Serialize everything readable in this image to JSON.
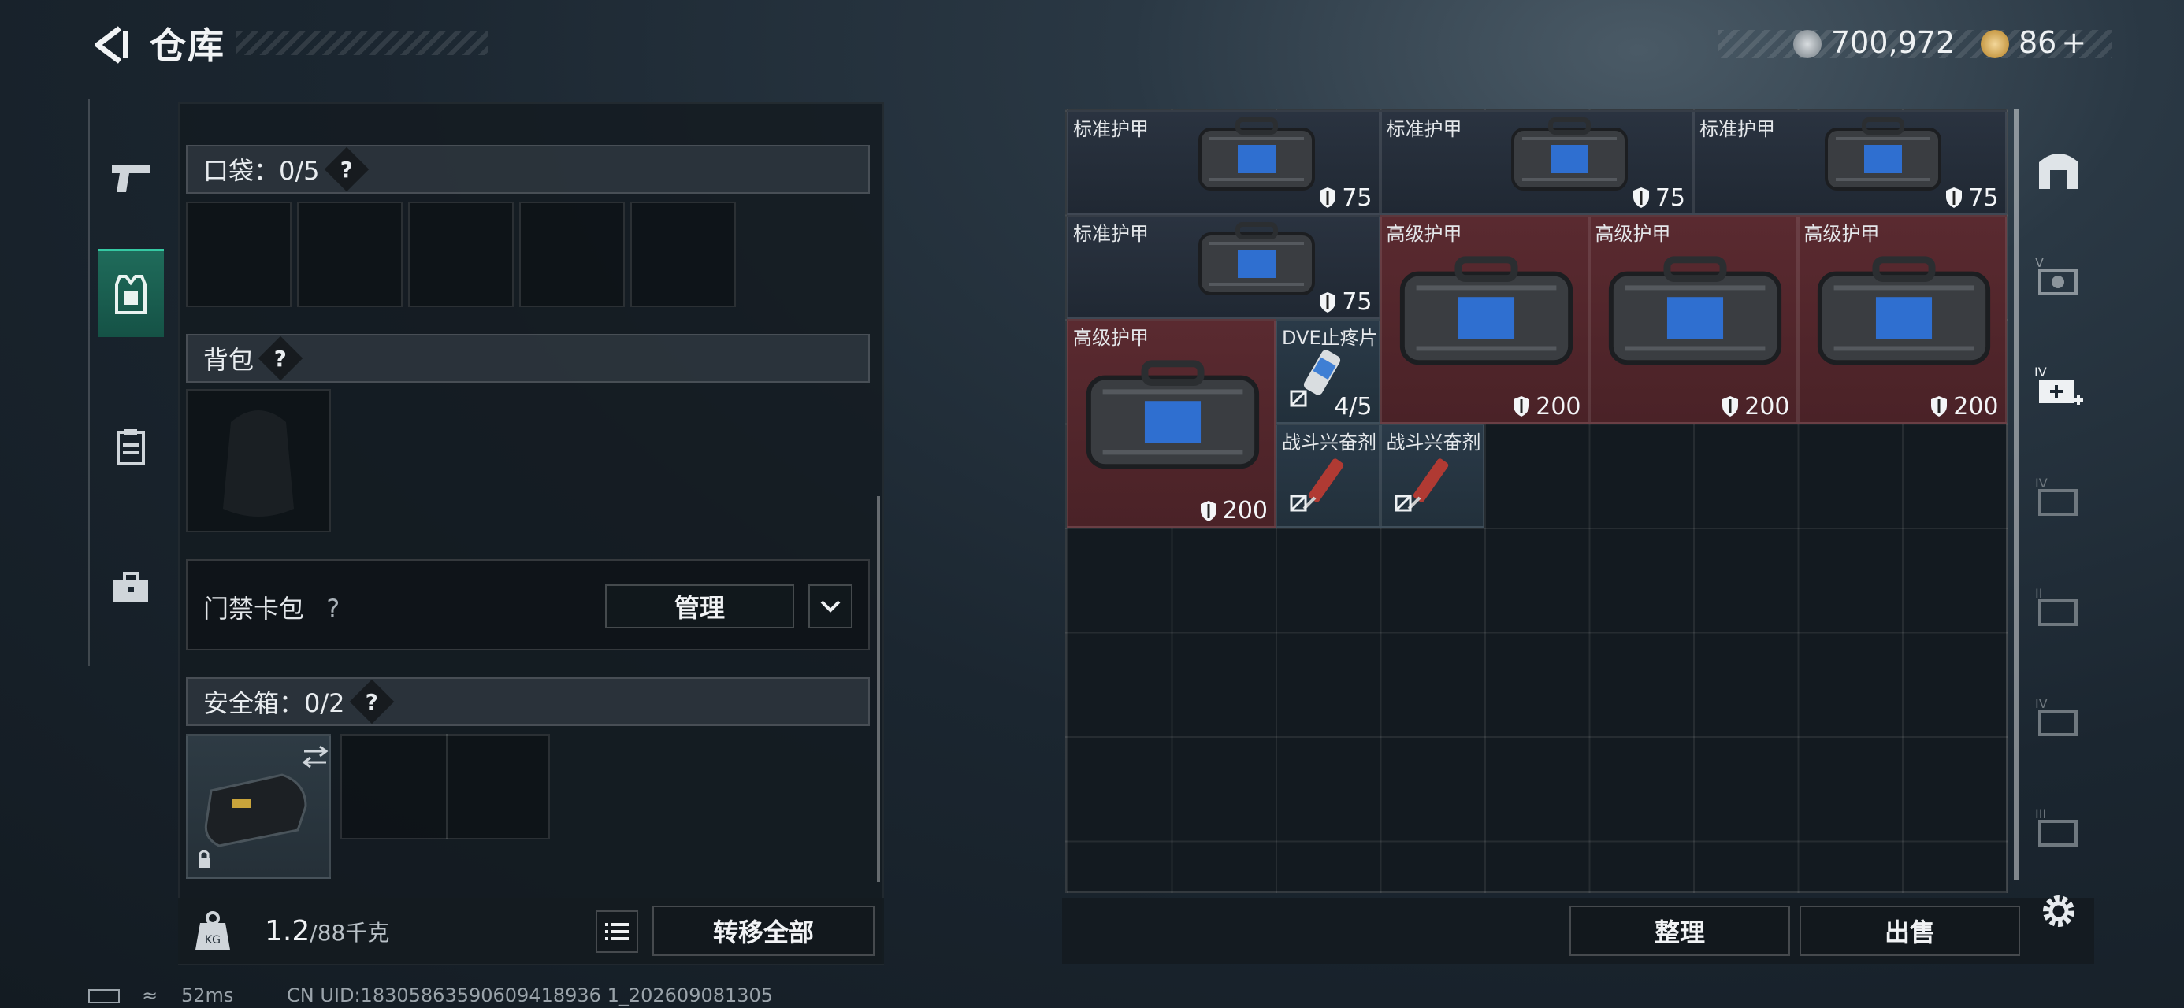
{
  "header": {
    "title": "仓库",
    "currency_silver": "700,972",
    "currency_gold": "86",
    "currency_gold_plus": "+"
  },
  "left_panel": {
    "pockets_label": "口袋：0/5",
    "backpack_label": "背包",
    "access_card_label": "门禁卡包",
    "manage_button": "管理",
    "safebox_label": "安全箱：0/2",
    "weight_value": "1.2",
    "weight_max": "/88千克",
    "transfer_all_button": "转移全部",
    "weight_icon_text": "KG",
    "question_mark": "?"
  },
  "grid_items": [
    {
      "name": "标准护甲",
      "value": "75"
    },
    {
      "name": "标准护甲",
      "value": "75"
    },
    {
      "name": "标准护甲",
      "value": "75"
    },
    {
      "name": "标准护甲",
      "value": "75"
    },
    {
      "name": "高级护甲",
      "value": "200"
    },
    {
      "name": "高级护甲",
      "value": "200"
    },
    {
      "name": "高级护甲",
      "value": "200"
    },
    {
      "name": "高级护甲",
      "value": "200"
    },
    {
      "name": "DVE止疼片",
      "value": "4/5"
    },
    {
      "name": "战斗兴奋剂",
      "value": ""
    },
    {
      "name": "战斗兴奋剂",
      "value": ""
    }
  ],
  "bottom_right": {
    "sort_button": "整理",
    "sell_button": "出售"
  },
  "right_rail_levels": [
    "V",
    "IV",
    "IV",
    "II",
    "IV",
    "III"
  ],
  "status_bar": {
    "ping": "52ms",
    "uid": "CN UID:18305863590609418936 1_202609081305"
  },
  "colors": {
    "standard_armor_bg": "#2a3340",
    "advanced_armor_bg": "#5a2a30",
    "active_tab": "#1f6b5a"
  }
}
